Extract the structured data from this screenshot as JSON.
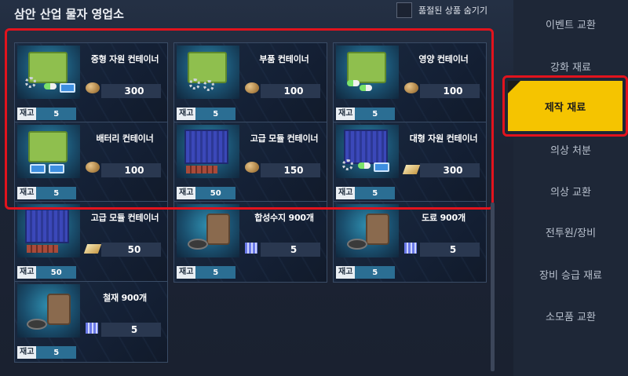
{
  "header": {
    "shop_title": "삼안 산업 물자 영업소",
    "hide_sold_out_label": "품절된 상품 숨기기"
  },
  "stock_label": "재고",
  "items": [
    {
      "name": "중형 자원 컨테이너",
      "stock": "5",
      "price": "300",
      "currency": "ore-icon"
    },
    {
      "name": "부품 컨테이너",
      "stock": "5",
      "price": "100",
      "currency": "ore-icon"
    },
    {
      "name": "영양 컨테이너",
      "stock": "5",
      "price": "100",
      "currency": "ore-icon"
    },
    {
      "name": "배터리 컨테이너",
      "stock": "5",
      "price": "100",
      "currency": "ore-icon"
    },
    {
      "name": "고급 모듈 컨테이너",
      "stock": "50",
      "price": "150",
      "currency": "ore-icon"
    },
    {
      "name": "대형 자원 컨테이너",
      "stock": "5",
      "price": "300",
      "currency": "ingot-icon"
    },
    {
      "name": "고급 모듈 컨테이너",
      "stock": "50",
      "price": "50",
      "currency": "ingot-icon"
    },
    {
      "name": "합성수지 900개",
      "stock": "5",
      "price": "5",
      "currency": "crystal-icon"
    },
    {
      "name": "도료 900개",
      "stock": "5",
      "price": "5",
      "currency": "crystal-icon"
    },
    {
      "name": "철재 900개",
      "stock": "5",
      "price": "5",
      "currency": "crystal-icon"
    }
  ],
  "sidebar": {
    "items": [
      {
        "label": "이벤트 교환"
      },
      {
        "label": "강화 재료"
      },
      {
        "label": "제작 재료",
        "active": true
      },
      {
        "label": "의상 처분"
      },
      {
        "label": "의상 교환"
      },
      {
        "label": "전투원/장비"
      },
      {
        "label": "장비 승급 재료"
      },
      {
        "label": "소모품 교환"
      }
    ]
  },
  "colors": {
    "active_tab": "#f5c400",
    "highlight_border": "#e2131d",
    "stock_badge": "#2b6e93"
  }
}
